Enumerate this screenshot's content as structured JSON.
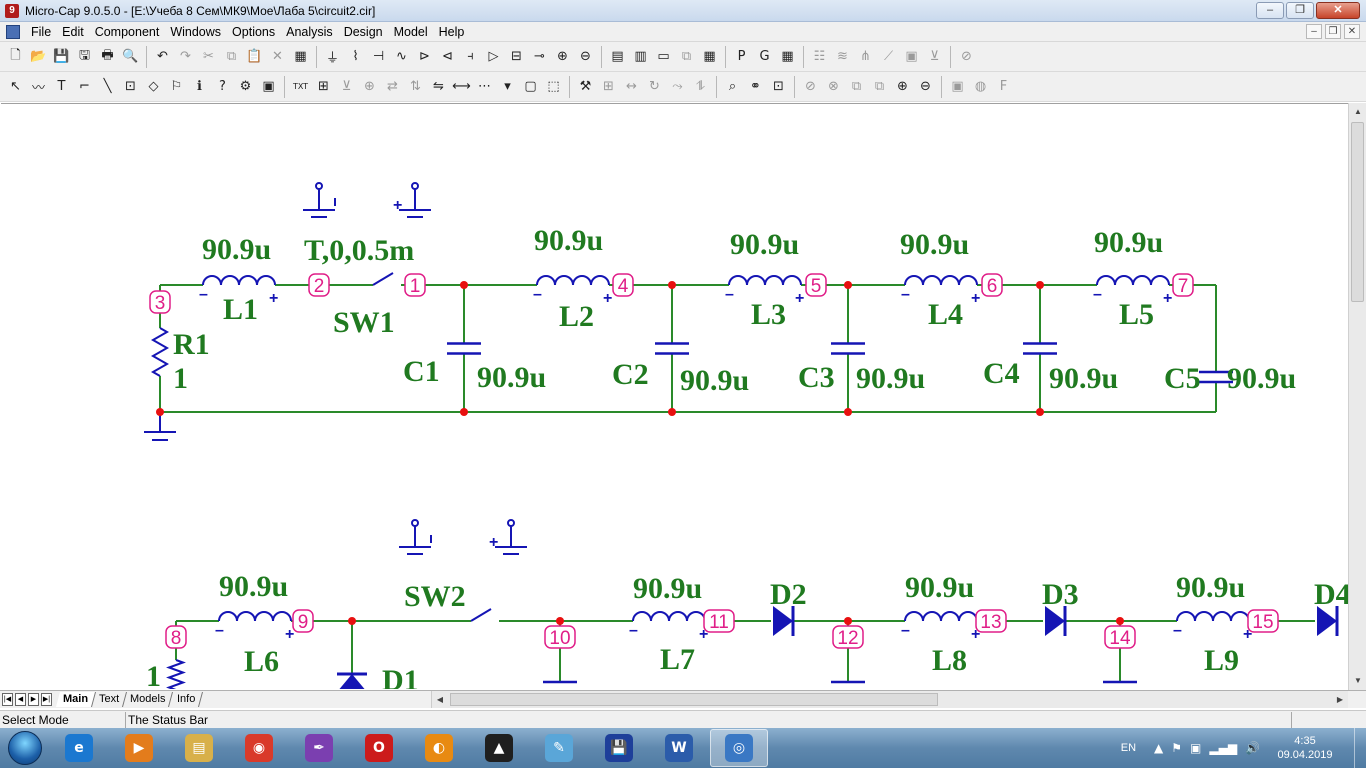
{
  "window": {
    "title": "Micro-Cap 9.0.5.0 - [E:\\Учеба 8 Сем\\МК9\\Мое\\Лаба 5\\circuit2.cir]",
    "controls": {
      "minimize": "–",
      "maximize": "❐",
      "close": "✕"
    }
  },
  "menu": {
    "items": [
      "File",
      "Edit",
      "Component",
      "Windows",
      "Options",
      "Analysis",
      "Design",
      "Model",
      "Help"
    ],
    "mdi": {
      "minimize": "–",
      "restore": "❐",
      "close": "✕"
    }
  },
  "toolbar1": {
    "buttons": [
      {
        "name": "new-icon",
        "glyph": "🗋"
      },
      {
        "name": "open-icon",
        "glyph": "📂"
      },
      {
        "name": "save-icon",
        "glyph": "💾"
      },
      {
        "name": "save-all-icon",
        "glyph": "🖫"
      },
      {
        "name": "print-icon",
        "glyph": "🖶"
      },
      {
        "name": "print-preview-icon",
        "glyph": "🔍"
      },
      {
        "sep": true
      },
      {
        "name": "undo-icon",
        "glyph": "↶"
      },
      {
        "name": "redo-icon",
        "glyph": "↷",
        "dim": true
      },
      {
        "name": "cut-icon",
        "glyph": "✂",
        "dim": true
      },
      {
        "name": "copy-icon",
        "glyph": "⧉",
        "dim": true
      },
      {
        "name": "paste-icon",
        "glyph": "📋",
        "dim": true
      },
      {
        "name": "delete-icon",
        "glyph": "✕",
        "dim": true
      },
      {
        "name": "chip-icon",
        "glyph": "▦"
      },
      {
        "sep": true
      },
      {
        "name": "ground-icon",
        "glyph": "⏚"
      },
      {
        "name": "resistor-icon",
        "glyph": "⌇"
      },
      {
        "name": "capacitor-icon",
        "glyph": "⊣"
      },
      {
        "name": "inductor-icon",
        "glyph": "∿"
      },
      {
        "name": "diode-icon",
        "glyph": "⊳"
      },
      {
        "name": "npn-icon",
        "glyph": "⊲"
      },
      {
        "name": "mosfet-icon",
        "glyph": "⫞"
      },
      {
        "name": "opamp-icon",
        "glyph": "▷"
      },
      {
        "name": "battery-icon",
        "glyph": "⊟"
      },
      {
        "name": "source-icon",
        "glyph": "⊸"
      },
      {
        "name": "voltage-source-icon",
        "glyph": "⊕"
      },
      {
        "name": "current-source-icon",
        "glyph": "⊖"
      },
      {
        "sep": true
      },
      {
        "name": "window-split-h-icon",
        "glyph": "▤"
      },
      {
        "name": "window-split-v-icon",
        "glyph": "▥"
      },
      {
        "name": "window-icon",
        "glyph": "▭"
      },
      {
        "name": "window-cascade-icon",
        "glyph": "⧉",
        "dim": true
      },
      {
        "name": "calculator-icon",
        "glyph": "▦"
      },
      {
        "sep": true
      },
      {
        "name": "pin-p-icon",
        "glyph": "P"
      },
      {
        "name": "pin-g-icon",
        "glyph": "G"
      },
      {
        "name": "grid-window-icon",
        "glyph": "▦"
      },
      {
        "sep": true
      },
      {
        "name": "analysis-1-icon",
        "glyph": "☷",
        "dim": true
      },
      {
        "name": "analysis-2-icon",
        "glyph": "≋",
        "dim": true
      },
      {
        "name": "analysis-3-icon",
        "glyph": "⋔",
        "dim": true
      },
      {
        "name": "probe-icon",
        "glyph": "⟋",
        "dim": true
      },
      {
        "name": "analysis-4-icon",
        "glyph": "▣",
        "dim": true
      },
      {
        "name": "analysis-5-icon",
        "glyph": "⊻",
        "dim": true
      },
      {
        "sep": true
      },
      {
        "name": "analysis-6-icon",
        "glyph": "⊘",
        "dim": true
      }
    ]
  },
  "toolbar2": {
    "buttons": [
      {
        "name": "select-arrow-icon",
        "glyph": "↖"
      },
      {
        "name": "wire-icon",
        "glyph": "〰"
      },
      {
        "name": "text-tool-icon",
        "glyph": "T"
      },
      {
        "name": "ortho-wire-icon",
        "glyph": "⌐"
      },
      {
        "name": "diagonal-wire-icon",
        "glyph": "╲"
      },
      {
        "name": "flag-component-icon",
        "glyph": "⊡"
      },
      {
        "name": "graphics-icon",
        "glyph": "◇"
      },
      {
        "name": "flag-icon",
        "glyph": "⚐"
      },
      {
        "name": "info-icon",
        "glyph": "ℹ"
      },
      {
        "name": "help-cursor-icon",
        "glyph": "?"
      },
      {
        "name": "component-info-icon",
        "glyph": "⚙"
      },
      {
        "name": "attribute-icon",
        "glyph": "▣"
      },
      {
        "sep": true
      },
      {
        "name": "text-toggle-icon",
        "glyph": "TXT"
      },
      {
        "name": "pin-names-icon",
        "glyph": "⊞"
      },
      {
        "name": "node-numbers-icon",
        "glyph": "⊻",
        "dim": true
      },
      {
        "name": "rotate-1-icon",
        "glyph": "⊕",
        "dim": true
      },
      {
        "name": "rotate-2-icon",
        "glyph": "⇄",
        "dim": true
      },
      {
        "name": "rotate-3-icon",
        "glyph": "⇅",
        "dim": true
      },
      {
        "name": "mirror-icon",
        "glyph": "⇋"
      },
      {
        "name": "bus-icon",
        "glyph": "⟷"
      },
      {
        "name": "grid-dots-icon",
        "glyph": "⋯"
      },
      {
        "name": "dropdown-icon",
        "glyph": "▾"
      },
      {
        "name": "box-icon",
        "glyph": "▢"
      },
      {
        "name": "page-icon",
        "glyph": "⬚"
      },
      {
        "sep": true
      },
      {
        "name": "properties-icon",
        "glyph": "⚒"
      },
      {
        "name": "align-icon",
        "glyph": "⊞",
        "dim": true
      },
      {
        "name": "flip-h-icon",
        "glyph": "↔",
        "dim": true
      },
      {
        "name": "rotate-icon",
        "glyph": "↻",
        "dim": true
      },
      {
        "name": "step-icon",
        "glyph": "⤳",
        "dim": true
      },
      {
        "name": "mirror-v-icon",
        "glyph": "⥮",
        "dim": true
      },
      {
        "sep": true
      },
      {
        "name": "find-icon",
        "glyph": "⌕"
      },
      {
        "name": "binoculars-icon",
        "glyph": "⚭"
      },
      {
        "name": "component-view-icon",
        "glyph": "⊡"
      },
      {
        "sep": true
      },
      {
        "name": "stop-icon",
        "glyph": "⊘",
        "dim": true
      },
      {
        "name": "cancel-icon",
        "glyph": "⊗",
        "dim": true
      },
      {
        "name": "stack-1-icon",
        "glyph": "⧉",
        "dim": true
      },
      {
        "name": "stack-2-icon",
        "glyph": "⧉",
        "dim": true
      },
      {
        "name": "zoom-in-icon",
        "glyph": "⊕"
      },
      {
        "name": "zoom-out-icon",
        "glyph": "⊖"
      },
      {
        "sep": true
      },
      {
        "name": "camera-icon",
        "glyph": "▣",
        "dim": true
      },
      {
        "name": "globe-icon",
        "glyph": "◍",
        "dim": true
      },
      {
        "name": "function-icon",
        "glyph": "F",
        "dim": true
      }
    ]
  },
  "schematic": {
    "wire_color": "#2a8a2a",
    "part_color": "#1515b4",
    "label_color": "#207a20",
    "node_color": "#e01e88",
    "junction_color": "#e81010",
    "row1": {
      "inductors": [
        {
          "name": "L1",
          "value": "90.9u"
        },
        {
          "name": "L2",
          "value": "90.9u"
        },
        {
          "name": "L3",
          "value": "90.9u"
        },
        {
          "name": "L4",
          "value": "90.9u"
        },
        {
          "name": "L5",
          "value": "90.9u"
        }
      ],
      "capacitors": [
        {
          "name": "C1",
          "value": "90.9u"
        },
        {
          "name": "C2",
          "value": "90.9u"
        },
        {
          "name": "C3",
          "value": "90.9u"
        },
        {
          "name": "C4",
          "value": "90.9u"
        },
        {
          "name": "C5",
          "value": "90.9u"
        }
      ],
      "resistor": {
        "name": "R1",
        "value": "1"
      },
      "switch": {
        "name": "SW1",
        "param": "T,0,0.5m"
      },
      "nodes": [
        "3",
        "2",
        "1",
        "4",
        "5",
        "6",
        "7"
      ]
    },
    "row2": {
      "inductors": [
        {
          "name": "L6",
          "value": "90.9u"
        },
        {
          "name": "L7",
          "value": "90.9u"
        },
        {
          "name": "L8",
          "value": "90.9u"
        },
        {
          "name": "L9",
          "value": "90.9u"
        }
      ],
      "diodes": [
        "D1",
        "D2",
        "D3",
        "D4"
      ],
      "resistor_value": "1",
      "switch": {
        "name": "SW2"
      },
      "nodes": [
        "8",
        "9",
        "10",
        "11",
        "12",
        "13",
        "14",
        "15"
      ]
    }
  },
  "tabs": [
    "Main",
    "Text",
    "Models",
    "Info"
  ],
  "status": {
    "mode": "Select Mode",
    "message": "The Status Bar"
  },
  "taskbar": {
    "apps": [
      {
        "name": "ie-icon",
        "glyph": "e",
        "color": "#1b78d0"
      },
      {
        "name": "media-player-icon",
        "glyph": "▶",
        "color": "#e37c1c"
      },
      {
        "name": "explorer-icon",
        "glyph": "▤",
        "color": "#d8b04a"
      },
      {
        "name": "chrome-icon",
        "glyph": "◉",
        "color": "#d93a2a"
      },
      {
        "name": "inkscape-icon",
        "glyph": "✒",
        "color": "#7b3fb0"
      },
      {
        "name": "opera-icon",
        "glyph": "O",
        "color": "#cc1b1b"
      },
      {
        "name": "aimp-icon",
        "glyph": "◐",
        "color": "#e88a12"
      },
      {
        "name": "archicad-icon",
        "glyph": "▲",
        "color": "#1f1f1f"
      },
      {
        "name": "notepad-icon",
        "glyph": "✎",
        "color": "#5aa6d8"
      },
      {
        "name": "floppy-icon",
        "glyph": "💾",
        "color": "#1e3f9a"
      },
      {
        "name": "word-icon",
        "glyph": "W",
        "color": "#2b5caa"
      },
      {
        "name": "microcap-icon",
        "glyph": "◎",
        "color": "#3a78c4"
      }
    ],
    "tray": {
      "language": "EN",
      "time": "4:35",
      "date": "09.04.2019"
    }
  }
}
